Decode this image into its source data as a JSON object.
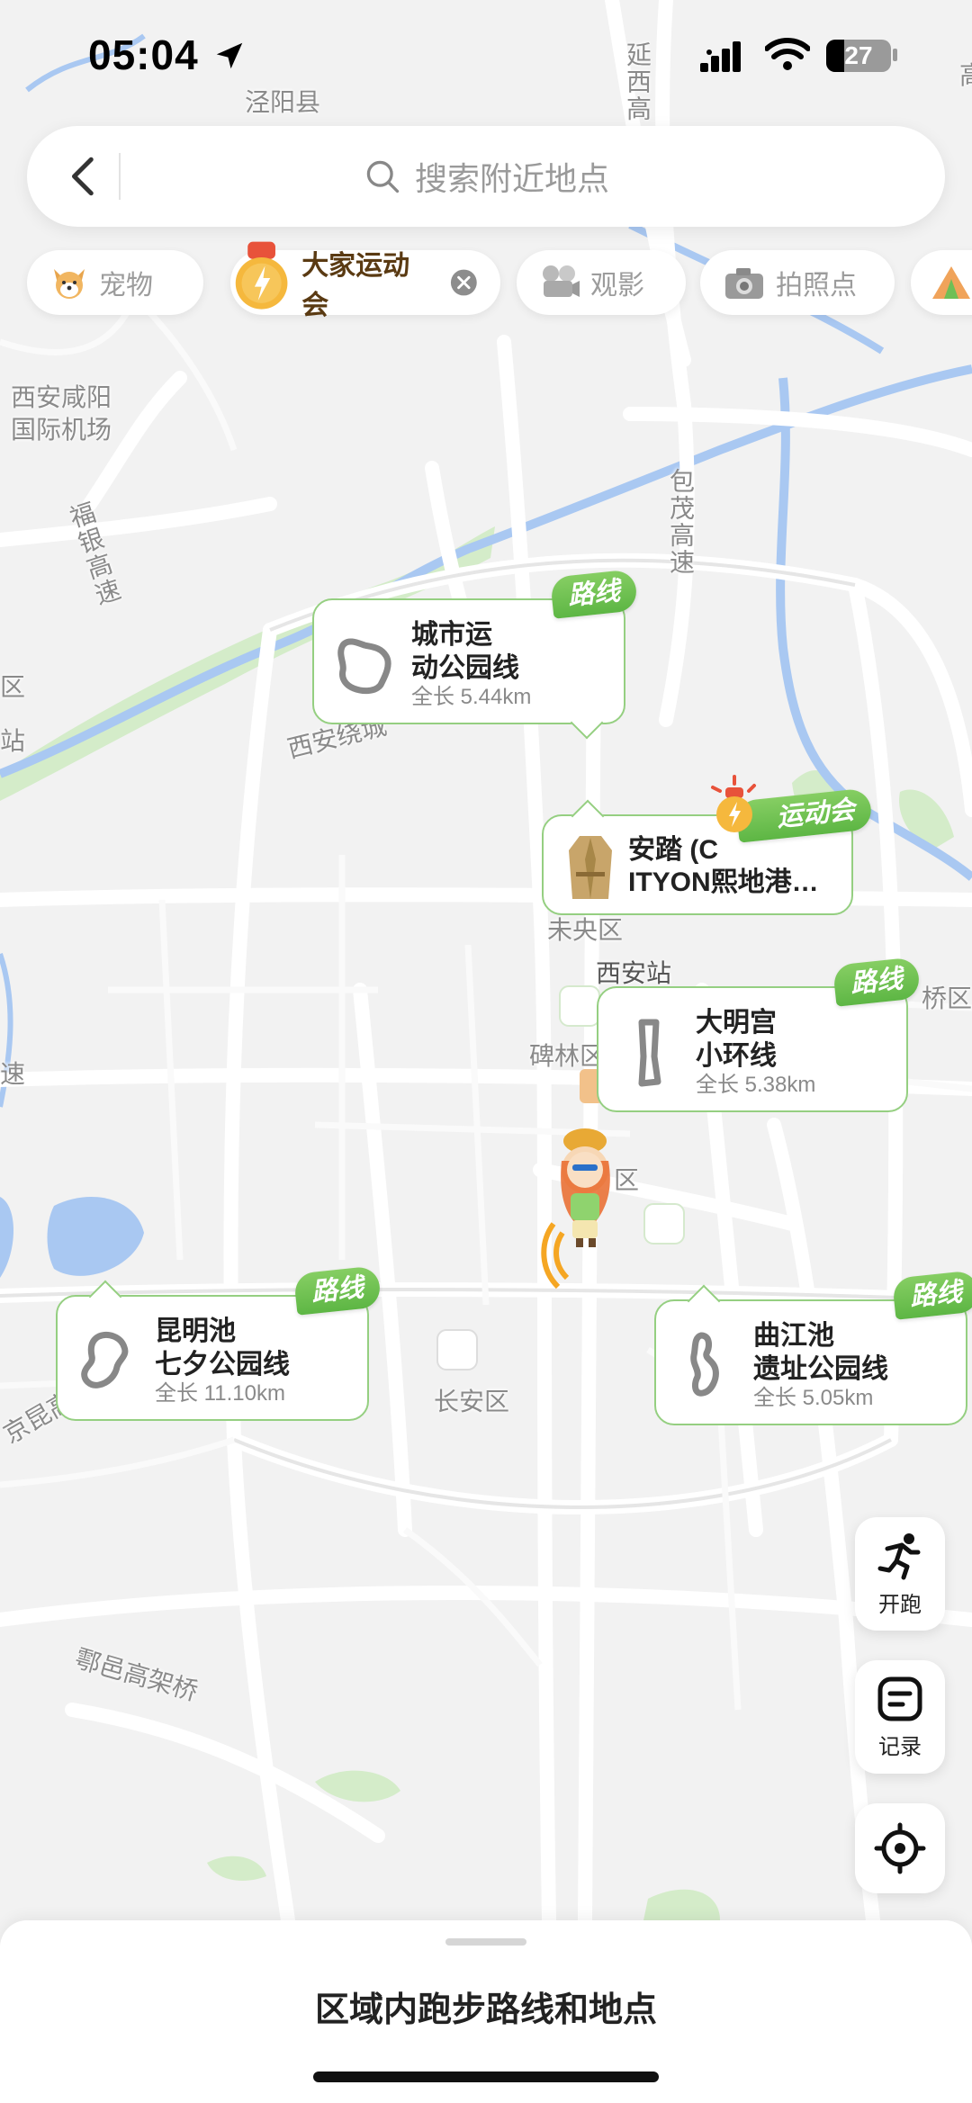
{
  "status_bar": {
    "time": "05:04",
    "battery": "27",
    "location_icon": "location-arrow-icon"
  },
  "search": {
    "placeholder": "搜索附近地点"
  },
  "filters": [
    {
      "label": "宠物",
      "icon": "dog-icon"
    },
    {
      "label": "大家运动会",
      "icon": "medal-icon",
      "active": true
    },
    {
      "label": "观影",
      "icon": "projector-icon"
    },
    {
      "label": "拍照点",
      "icon": "camera-icon"
    }
  ],
  "map_labels": {
    "jingyang": "泾阳县",
    "yanxi": "延西高",
    "airport_1": "西安咸阳",
    "airport_2": "国际机场",
    "fuyin": "福银高速",
    "baomao": "包茂高速",
    "xian_ring": "西安绕城",
    "weiyang": "未央区",
    "xian_station": "西安站",
    "beilin": "碑林区",
    "qiao": "桥区",
    "qu": "区",
    "changan": "长安区",
    "huyi": "鄠邑高架桥",
    "jing_kun": "京昆高",
    "left_qu": "区",
    "left_zhan": "站",
    "left_su": "速",
    "gao_right": "高"
  },
  "route_cards": [
    {
      "tag": "路线",
      "title_1": "城市运",
      "title_2": "动公园线",
      "length": "全长 5.44km"
    },
    {
      "tag": "路线",
      "title_1": "大明宫",
      "title_2": "小环线",
      "length": "全长 5.38km"
    },
    {
      "tag": "路线",
      "title_1": "昆明池",
      "title_2": "七夕公园线",
      "length": "全长 11.10km"
    },
    {
      "tag": "路线",
      "title_1": "曲江池",
      "title_2": "遗址公园线",
      "length": "全长 5.05km"
    }
  ],
  "store_card": {
    "tag": "运动会",
    "title_1": "安踏 (C",
    "title_2": "ITYON熙地港…"
  },
  "side_buttons": {
    "run": "开跑",
    "records": "记录"
  },
  "bottom_sheet": {
    "title": "区域内跑步路线和地点"
  },
  "colors": {
    "accent_green": "#5db644",
    "card_border": "#95cf81",
    "water": "#a9c8f2",
    "park": "#d4ecc9"
  }
}
